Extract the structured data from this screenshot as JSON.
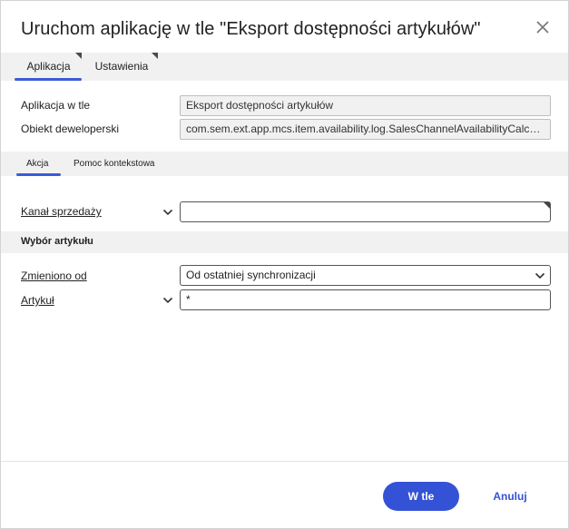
{
  "dialog": {
    "title": "Uruchom aplikację w tle \"Eksport dostępności artykułów\"",
    "close_icon": "close-icon"
  },
  "tabs": [
    {
      "label": "Aplikacja",
      "active": true
    },
    {
      "label": "Ustawienia",
      "active": false
    }
  ],
  "fields": {
    "app_label": "Aplikacja w tle",
    "app_value": "Eksport dostępności artykułów",
    "dev_label": "Obiekt deweloperski",
    "dev_value": "com.sem.ext.app.mcs.item.availability.log.SalesChannelAvailabilityCalcula..."
  },
  "subtabs": [
    {
      "label": "Akcja",
      "active": true
    },
    {
      "label": "Pomoc kontekstowa",
      "active": false
    }
  ],
  "form": {
    "channel_label": "Kanał sprzedaży",
    "channel_value": "",
    "section_title": "Wybór artykułu",
    "changed_label": "Zmieniono od",
    "changed_value": "Od ostatniej synchronizacji",
    "item_label": "Artykuł",
    "item_value": "*"
  },
  "buttons": {
    "primary": "W tle",
    "cancel": "Anuluj"
  },
  "colors": {
    "accent": "#3452d6",
    "header_bg": "#f1f1f1"
  }
}
